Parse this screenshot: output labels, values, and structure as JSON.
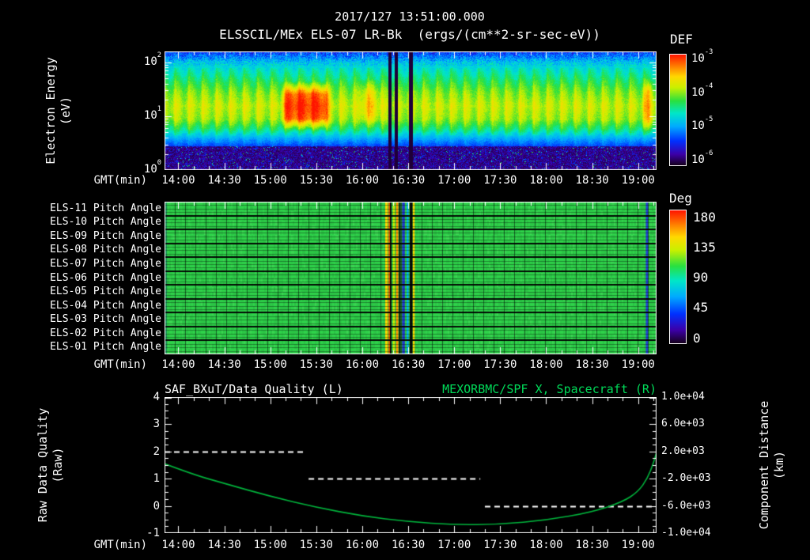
{
  "header": {
    "timestamp": "2017/127 13:51:00.000",
    "title": "ELSSCIL/MEx ELS-07 LR-Bk  (ergs/(cm**2-sr-sec-eV))"
  },
  "colors": {
    "background": "#000000",
    "text": "#ffffff",
    "green_text": "#00d858",
    "green_curve": "#00b43c"
  },
  "time_axis": {
    "label": "GMT(min)",
    "range_gmt": [
      "13:51",
      "19:12"
    ],
    "ticks": [
      "14:00",
      "14:30",
      "15:00",
      "15:30",
      "16:00",
      "16:30",
      "17:00",
      "17:30",
      "18:00",
      "18:30",
      "19:00"
    ]
  },
  "spectrogram_panel": {
    "ylabel": "Electron Energy",
    "yunit": "(eV)",
    "yticks": [
      "10^2",
      "10^1",
      "10^0"
    ],
    "colorbar": {
      "title": "DEF",
      "ticks": [
        "10^-3",
        "10^-4",
        "10^-5",
        "10^-6"
      ]
    }
  },
  "pitch_panel": {
    "row_labels": [
      "ELS-11 Pitch Angle",
      "ELS-10 Pitch Angle",
      "ELS-09 Pitch Angle",
      "ELS-08 Pitch Angle",
      "ELS-07 Pitch Angle",
      "ELS-06 Pitch Angle",
      "ELS-05 Pitch Angle",
      "ELS-04 Pitch Angle",
      "ELS-03 Pitch Angle",
      "ELS-02 Pitch Angle",
      "ELS-01 Pitch Angle"
    ],
    "colorbar": {
      "title": "Deg",
      "ticks": [
        "180",
        "135",
        "90",
        "45",
        "0"
      ]
    }
  },
  "quality_panel": {
    "title_left": "SAF_BXuT/Data Quality (L)",
    "title_right": "MEXORBMC/SPF X, Spacecraft (R)",
    "ylabel_left": "Raw Data Quality",
    "yunit_left": "(Raw)",
    "ylabel_right": "Component Distance",
    "yunit_right": "(km)",
    "yticks_left": [
      "4",
      "3",
      "2",
      "1",
      "0",
      "-1"
    ],
    "yticks_right": [
      "1.0e+04",
      "6.0e+03",
      "2.0e+03",
      "-2.0e+03",
      "-6.0e+03",
      "-1.0e+04"
    ]
  },
  "chart_data": [
    {
      "id": "electron-energy-spectrogram",
      "type": "heatmap",
      "title": "ELSSCIL/MEx ELS-07 LR-Bk",
      "units": "ergs/(cm**2-sr-sec-eV)",
      "x_axis": {
        "label": "GMT(min)",
        "start": "13:51",
        "end": "19:12",
        "ticks": [
          "14:00",
          "14:30",
          "15:00",
          "15:30",
          "16:00",
          "16:30",
          "17:00",
          "17:30",
          "18:00",
          "18:30",
          "19:00"
        ]
      },
      "y_axis": {
        "label": "Electron Energy (eV)",
        "scale": "log",
        "range_ev": [
          1,
          160
        ],
        "ticks": [
          "10^0",
          "10^1",
          "10^2"
        ]
      },
      "z_axis": {
        "label": "DEF",
        "scale": "log",
        "ticks": [
          "10^-3",
          "10^-4",
          "10^-5",
          "10^-6"
        ]
      },
      "colormap_stops": [
        [
          0,
          "#16001c"
        ],
        [
          0.1,
          "#3c00a8"
        ],
        [
          0.22,
          "#0030ff"
        ],
        [
          0.35,
          "#00aaff"
        ],
        [
          0.47,
          "#00e6c8"
        ],
        [
          0.58,
          "#28e040"
        ],
        [
          0.7,
          "#c8f000"
        ],
        [
          0.8,
          "#ffd800"
        ],
        [
          0.9,
          "#ff7800"
        ],
        [
          1,
          "#ff1400"
        ]
      ],
      "energy_profile_log10ev_level": [
        [
          0,
          0.1
        ],
        [
          0.3,
          0.16
        ],
        [
          0.45,
          0.24
        ],
        [
          0.6,
          0.36
        ],
        [
          0.75,
          0.52
        ],
        [
          0.95,
          0.66
        ],
        [
          1.2,
          0.7
        ],
        [
          1.45,
          0.64
        ],
        [
          1.65,
          0.56
        ],
        [
          1.85,
          0.47
        ],
        [
          2,
          0.4
        ],
        [
          2.1,
          0.31
        ],
        [
          2.2,
          0.22
        ]
      ],
      "stripe_period_min": 9,
      "features": [
        {
          "kind": "burst",
          "label": "strong flux enhancement",
          "gmt": [
            "15:06",
            "15:40"
          ],
          "energy_ev": [
            7,
            35
          ],
          "boost": 0.27
        },
        {
          "kind": "burst",
          "label": "moderate enhancement",
          "gmt": [
            "15:57",
            "16:12"
          ],
          "energy_ev": [
            8,
            40
          ],
          "boost": 0.1
        },
        {
          "kind": "burst",
          "label": "enhancement near end of plot",
          "gmt": [
            "19:02",
            "19:11"
          ],
          "energy_ev": [
            6,
            40
          ],
          "boost": 0.2
        },
        {
          "kind": "gap",
          "label": "data gap",
          "gmt": [
            "16:17",
            "16:19"
          ]
        },
        {
          "kind": "gap",
          "label": "data gap",
          "gmt": [
            "16:21",
            "16:23"
          ]
        },
        {
          "kind": "gap",
          "label": "data gap",
          "gmt": [
            "16:30",
            "16:33"
          ]
        }
      ]
    },
    {
      "id": "pitch-angle-panel",
      "type": "heatmap",
      "rows": [
        "ELS-11",
        "ELS-10",
        "ELS-09",
        "ELS-08",
        "ELS-07",
        "ELS-06",
        "ELS-05",
        "ELS-04",
        "ELS-03",
        "ELS-02",
        "ELS-01"
      ],
      "value": "Pitch Angle",
      "units": "Deg",
      "z_range_deg": [
        0,
        180
      ],
      "typical_value_deg": 90,
      "background_color": "#2ed24a",
      "colorbar_ticks_deg": [
        180,
        135,
        90,
        45,
        0
      ],
      "anomaly_columns": [
        {
          "gmt": "16:15",
          "width_min": 1.5,
          "color": "#ffd800"
        },
        {
          "gmt": "16:17",
          "width_min": 1.2,
          "color": "#ff7800"
        },
        {
          "gmt": "16:18",
          "width_min": 1.0,
          "color": "#0a0a0a"
        },
        {
          "gmt": "16:20",
          "width_min": 1.2,
          "color": "#c8f000"
        },
        {
          "gmt": "16:22",
          "width_min": 1.5,
          "color": "#ff9400"
        },
        {
          "gmt": "16:24",
          "width_min": 1.0,
          "color": "#0a0a0a"
        },
        {
          "gmt": "16:26",
          "width_min": 1.8,
          "color": "#2238cc"
        },
        {
          "gmt": "16:29",
          "width_min": 1.2,
          "color": "#00b0ff"
        },
        {
          "gmt": "16:31",
          "width_min": 1.8,
          "color": "#0a0a0a"
        },
        {
          "gmt": "16:33",
          "width_min": 1.2,
          "color": "#ffd800"
        },
        {
          "gmt": "19:05",
          "width_min": 1.6,
          "color": "#2244d8"
        }
      ]
    },
    {
      "id": "raw-data-quality",
      "type": "line",
      "style": "dashed-step",
      "color": "#ffffff",
      "axis": "left",
      "y_range": [
        -1,
        4
      ],
      "segments": [
        {
          "gmt": [
            "13:51",
            "15:22"
          ],
          "value": 2
        },
        {
          "gmt": [
            "15:25",
            "17:17"
          ],
          "value": 1
        },
        {
          "gmt": [
            "17:20",
            "19:09"
          ],
          "value": 0
        }
      ]
    },
    {
      "id": "spacecraft-x-distance",
      "type": "line",
      "color": "#00b43c",
      "axis": "right",
      "y_range_km": [
        -10000,
        10000
      ],
      "points_gmt_km": [
        [
          "13:51",
          200
        ],
        [
          "14:10",
          -1400
        ],
        [
          "14:30",
          -2700
        ],
        [
          "15:00",
          -4600
        ],
        [
          "15:30",
          -6200
        ],
        [
          "16:00",
          -7500
        ],
        [
          "16:30",
          -8300
        ],
        [
          "17:00",
          -8800
        ],
        [
          "17:30",
          -8700
        ],
        [
          "18:00",
          -8100
        ],
        [
          "18:30",
          -6900
        ],
        [
          "18:50",
          -5400
        ],
        [
          "19:00",
          -3900
        ],
        [
          "19:06",
          -2000
        ],
        [
          "19:10",
          300
        ],
        [
          "19:12",
          1900
        ]
      ]
    }
  ]
}
